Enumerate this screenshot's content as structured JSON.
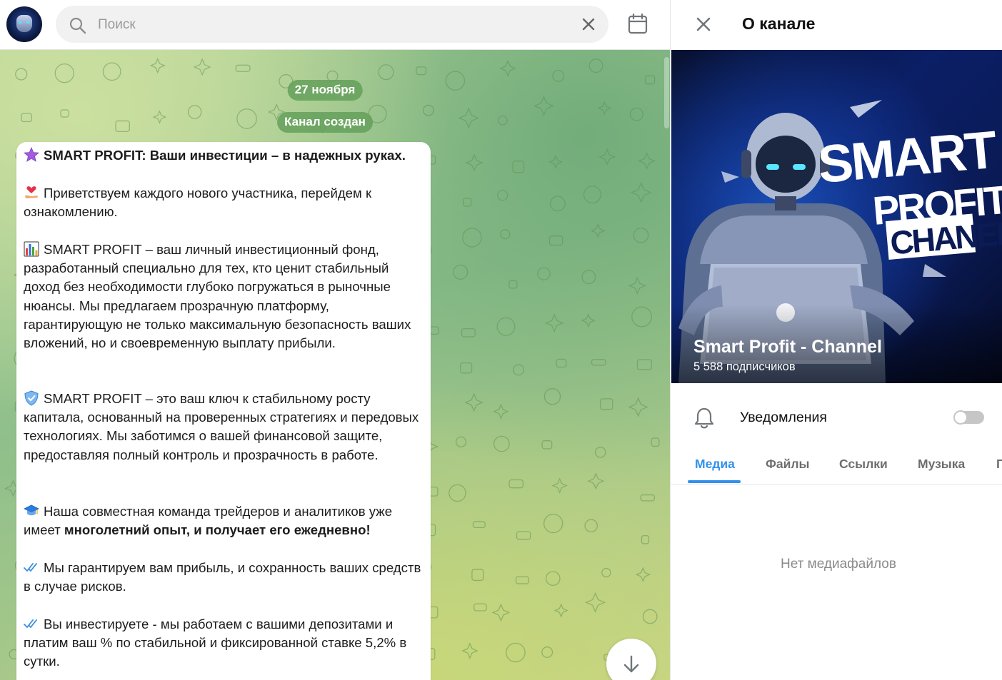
{
  "header": {
    "search": {
      "placeholder": "Поиск",
      "value": ""
    }
  },
  "chat": {
    "date_label": "27 ноября",
    "service_message": "Канал создан",
    "message": {
      "p1": {
        "emoji": "purple-star-icon",
        "text": "SMART PROFIT: Ваши инвестиции – в надежных руках."
      },
      "p2": {
        "emoji": "heart-hand-icon",
        "text": "Приветствуем каждого нового участника, перейдем к ознакомлению."
      },
      "p3": {
        "emoji": "bar-chart-icon",
        "lead": "SMART PROFIT",
        "text": " – ваш личный инвестиционный фонд, разработанный специально для тех, кто ценит стабильный доход без необходимости глубоко погружаться в рыночные нюансы. Мы предлагаем прозрачную платформу, гарантирующую не только максимальную безопасность ваших вложений, но и своевременную выплату прибыли."
      },
      "p4": {
        "emoji": "shield-icon",
        "lead": "SMART PROFIT",
        "text": " – это ваш ключ к стабильному росту капитала, основанный на проверенных стратегиях и передовых технологиях. Мы заботимся о вашей финансовой защите, предоставляя полный контроль и прозрачность в работе."
      },
      "p5": {
        "emoji": "graduation-cap-icon",
        "text": "Наша совместная команда трейдеров и аналитиков уже имеет ",
        "bold": "многолетний опыт, и получает его ежедневно!"
      },
      "p6": {
        "emoji": "double-check-icon",
        "text": "Мы гарантируем вам прибыль, и сохранность ваших средств в случае рисков."
      },
      "p7": {
        "emoji": "double-check-icon",
        "text": "Вы инвестируете - мы работаем с вашими депозитами и платим ваш % по стабильной и фиксированной ставке 5,2% в сутки."
      }
    }
  },
  "panel": {
    "title": "О канале",
    "channel_name": "Smart Profit - Channel",
    "subscribers": "5 588 подписчиков",
    "cover_text": {
      "line1": "SMART",
      "line2": "PROFIT",
      "line3": "CHANEL"
    },
    "notifications_label": "Уведомления",
    "notifications_on": false,
    "tabs": [
      "Медиа",
      "Файлы",
      "Ссылки",
      "Музыка",
      "Г"
    ],
    "active_tab": "Медиа",
    "empty_text": "Нет медиафайлов"
  },
  "colors": {
    "accent": "#3390ec",
    "service_pill": "#64a05a"
  }
}
